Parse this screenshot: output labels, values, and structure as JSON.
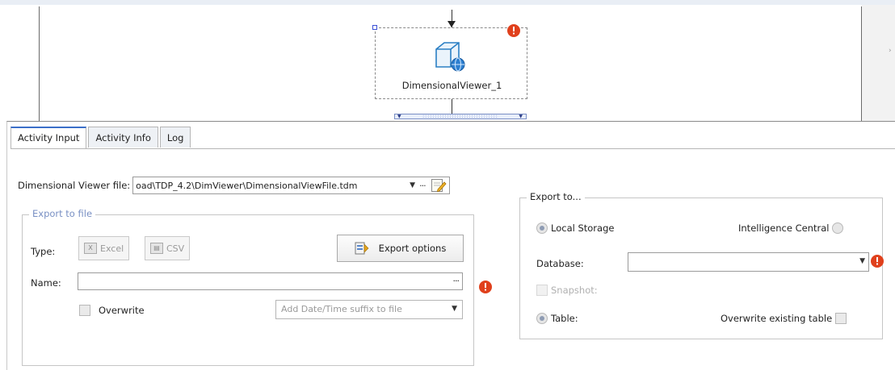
{
  "canvas": {
    "node": {
      "label": "DimensionalViewer_1",
      "icon": "cube-globe-icon",
      "error_icon": "error-icon"
    }
  },
  "tabs": [
    {
      "label": "Activity Input",
      "active": true
    },
    {
      "label": "Activity Info",
      "active": false
    },
    {
      "label": "Log",
      "active": false
    }
  ],
  "dimensional_viewer": {
    "label": "Dimensional Viewer file:",
    "value": "oad\\TDP_4.2\\DimViewer\\DimensionalViewFile.tdm",
    "dropdown_glyph": "▼",
    "browse_glyph": "···"
  },
  "export_to_file": {
    "title": "Export to file",
    "type_label": "Type:",
    "excel_label": "Excel",
    "csv_label": "CSV",
    "export_options_label": "Export options",
    "name_label": "Name:",
    "name_value": "",
    "browse_glyph": "···",
    "overwrite_label": "Overwrite",
    "suffix_placeholder": "Add Date/Time suffix to file"
  },
  "export_to": {
    "title": "Export to...",
    "local_storage_label": "Local Storage",
    "intelligence_central_label": "Intelligence Central",
    "database_label": "Database:",
    "database_value": "",
    "snapshot_label": "Snapshot:",
    "table_label": "Table:",
    "overwrite_table_label": "Overwrite existing table"
  },
  "colors": {
    "error": "#e0401c",
    "accent": "#3b6fc9",
    "group_title": "#7990c4"
  }
}
